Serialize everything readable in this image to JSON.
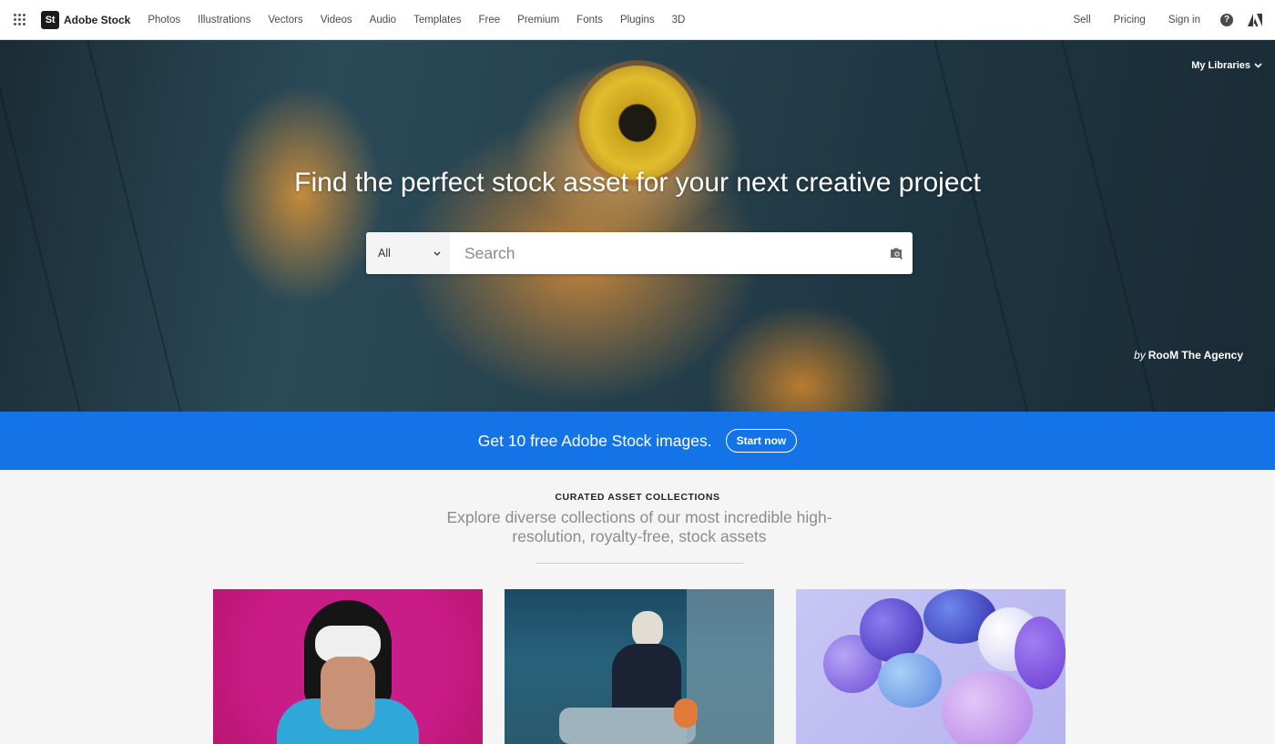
{
  "nav": {
    "brand_mark": "St",
    "brand_name": "Adobe Stock",
    "links": [
      "Photos",
      "Illustrations",
      "Vectors",
      "Videos",
      "Audio",
      "Templates",
      "Free",
      "Premium",
      "Fonts",
      "Plugins",
      "3D"
    ],
    "right_links": [
      "Sell",
      "Pricing",
      "Sign in"
    ],
    "help_glyph": "?"
  },
  "hero": {
    "headline": "Find the perfect stock asset for your next creative project",
    "my_libraries": "My Libraries",
    "credit_prefix": "by",
    "credit_name": "RooM The Agency",
    "search": {
      "type_value": "All",
      "placeholder": "Search"
    }
  },
  "promo": {
    "text": "Get 10 free Adobe Stock images.",
    "button": "Start now"
  },
  "collections": {
    "eyebrow": "CURATED ASSET COLLECTIONS",
    "subtitle": "Explore diverse collections of our most incredible high-resolution, royalty-free, stock assets"
  },
  "colors": {
    "promo_blue": "#1473e6",
    "nav_bg": "#ffffff",
    "page_bg": "#f5f5f5"
  },
  "icons": {
    "apps": "apps-grid-icon",
    "help": "help-icon",
    "adobe": "adobe-logo-icon",
    "visual_search": "visual-search-icon",
    "chevron": "chevron-down-icon"
  }
}
